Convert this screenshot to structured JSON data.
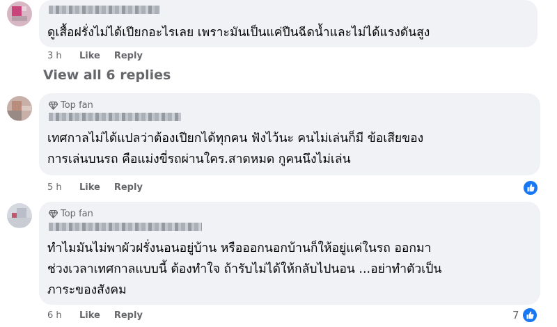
{
  "comments": [
    {
      "text_lines": [
        "ดูเสื้อฝรั่งไม่ได้เปียกอะไรเลย เพราะมันเป็นแค่ปืนฉีดน้ำและไม่ได้แรงดันสูง"
      ],
      "time": "3 h",
      "like_label": "Like",
      "reply_label": "Reply"
    },
    {
      "badge": "Top fan",
      "text_lines": [
        "เทศกาลไม่ได้แปลว่าต้องเปียกได้ทุกคน ฟังไว้นะ คนไม่เล่นก็มี ข้อเสียของ",
        "การเล่นบนรถ คือแม่งขี่รถผ่านใคร.สาดหมด กูคนนึงไม่เล่น"
      ],
      "time": "5 h",
      "like_label": "Like",
      "reply_label": "Reply"
    },
    {
      "badge": "Top fan",
      "text_lines": [
        "ทำไมมันไม่พาผัวฝรั่งนอนอยู่บ้าน หรือออกนอกบ้านก็ให้อยู่แค่ในรถ ออกมา",
        "ช่วงเวลาเทศกาลแบบนี้ ต้องทำใจ ถ้ารับไม่ได้ให้กลับไปนอน ...อย่าทำตัวเป็น",
        "ภาระของสังคม"
      ],
      "time": "6 h",
      "like_label": "Like",
      "reply_label": "Reply",
      "reaction_count": "7"
    }
  ],
  "view_all_replies": "View all 6 replies",
  "colors": {
    "bubble": "#f0f2f5",
    "secondary_text": "#65676b",
    "like_blue": "#1877f2"
  },
  "icons": {
    "top_fan": "diamond-icon",
    "reaction": "thumbs-up-icon"
  }
}
